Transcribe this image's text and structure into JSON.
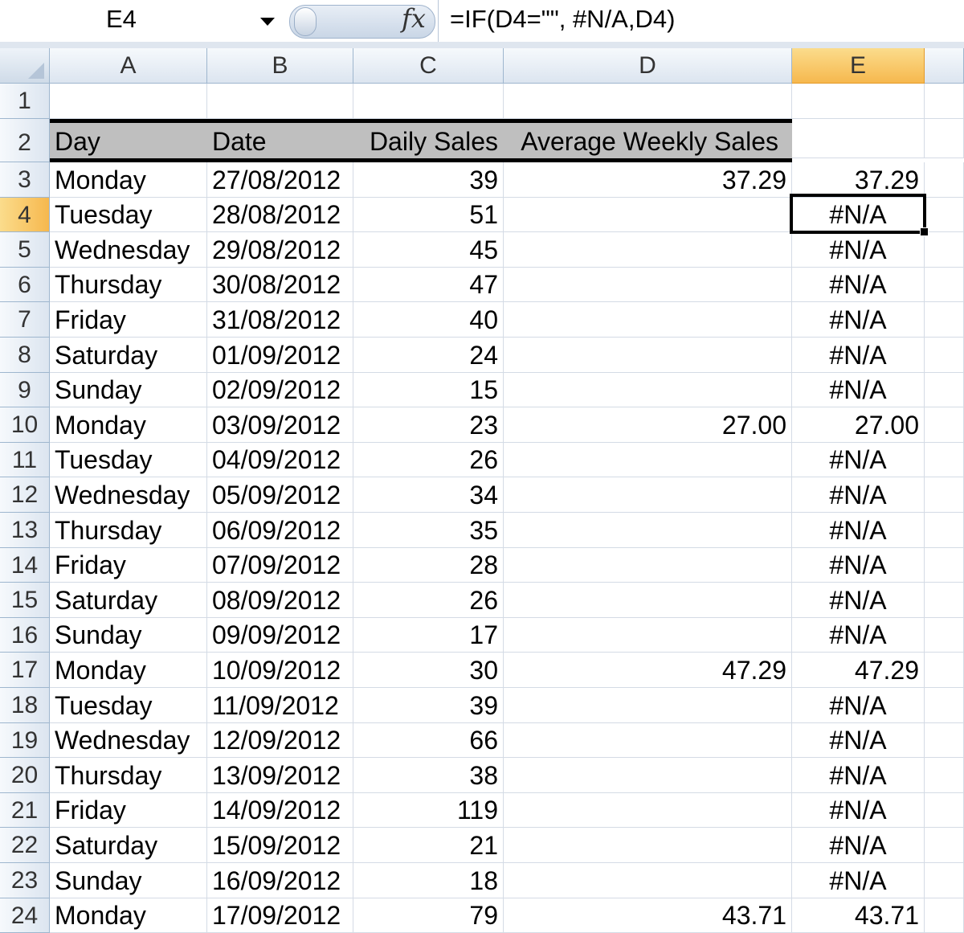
{
  "formula_bar": {
    "name_box": "E4",
    "fx_label": "fx",
    "formula": "=IF(D4=\"\", #N/A,D4)"
  },
  "columns": [
    "A",
    "B",
    "C",
    "D",
    "E"
  ],
  "active_column": "E",
  "active_row": "4",
  "header_row": {
    "row": "2",
    "day": "Day",
    "date": "Date",
    "daily_sales": "Daily Sales",
    "avg_weekly_sales": "Average Weekly Sales"
  },
  "rows": [
    {
      "n": "1",
      "day": "",
      "date": "",
      "sales": "",
      "avg": "",
      "e": ""
    },
    {
      "n": "3",
      "day": "Monday",
      "date": "27/08/2012",
      "sales": "39",
      "avg": "37.29",
      "e": "37.29"
    },
    {
      "n": "4",
      "day": "Tuesday",
      "date": "28/08/2012",
      "sales": "51",
      "avg": "",
      "e": "#N/A"
    },
    {
      "n": "5",
      "day": "Wednesday",
      "date": "29/08/2012",
      "sales": "45",
      "avg": "",
      "e": "#N/A"
    },
    {
      "n": "6",
      "day": "Thursday",
      "date": "30/08/2012",
      "sales": "47",
      "avg": "",
      "e": "#N/A"
    },
    {
      "n": "7",
      "day": "Friday",
      "date": "31/08/2012",
      "sales": "40",
      "avg": "",
      "e": "#N/A"
    },
    {
      "n": "8",
      "day": "Saturday",
      "date": "01/09/2012",
      "sales": "24",
      "avg": "",
      "e": "#N/A"
    },
    {
      "n": "9",
      "day": "Sunday",
      "date": "02/09/2012",
      "sales": "15",
      "avg": "",
      "e": "#N/A"
    },
    {
      "n": "10",
      "day": "Monday",
      "date": "03/09/2012",
      "sales": "23",
      "avg": "27.00",
      "e": "27.00"
    },
    {
      "n": "11",
      "day": "Tuesday",
      "date": "04/09/2012",
      "sales": "26",
      "avg": "",
      "e": "#N/A"
    },
    {
      "n": "12",
      "day": "Wednesday",
      "date": "05/09/2012",
      "sales": "34",
      "avg": "",
      "e": "#N/A"
    },
    {
      "n": "13",
      "day": "Thursday",
      "date": "06/09/2012",
      "sales": "35",
      "avg": "",
      "e": "#N/A"
    },
    {
      "n": "14",
      "day": "Friday",
      "date": "07/09/2012",
      "sales": "28",
      "avg": "",
      "e": "#N/A"
    },
    {
      "n": "15",
      "day": "Saturday",
      "date": "08/09/2012",
      "sales": "26",
      "avg": "",
      "e": "#N/A"
    },
    {
      "n": "16",
      "day": "Sunday",
      "date": "09/09/2012",
      "sales": "17",
      "avg": "",
      "e": "#N/A"
    },
    {
      "n": "17",
      "day": "Monday",
      "date": "10/09/2012",
      "sales": "30",
      "avg": "47.29",
      "e": "47.29"
    },
    {
      "n": "18",
      "day": "Tuesday",
      "date": "11/09/2012",
      "sales": "39",
      "avg": "",
      "e": "#N/A"
    },
    {
      "n": "19",
      "day": "Wednesday",
      "date": "12/09/2012",
      "sales": "66",
      "avg": "",
      "e": "#N/A"
    },
    {
      "n": "20",
      "day": "Thursday",
      "date": "13/09/2012",
      "sales": "38",
      "avg": "",
      "e": "#N/A"
    },
    {
      "n": "21",
      "day": "Friday",
      "date": "14/09/2012",
      "sales": "119",
      "avg": "",
      "e": "#N/A"
    },
    {
      "n": "22",
      "day": "Saturday",
      "date": "15/09/2012",
      "sales": "21",
      "avg": "",
      "e": "#N/A"
    },
    {
      "n": "23",
      "day": "Sunday",
      "date": "16/09/2012",
      "sales": "18",
      "avg": "",
      "e": "#N/A"
    },
    {
      "n": "24",
      "day": "Monday",
      "date": "17/09/2012",
      "sales": "79",
      "avg": "43.71",
      "e": "43.71"
    }
  ]
}
